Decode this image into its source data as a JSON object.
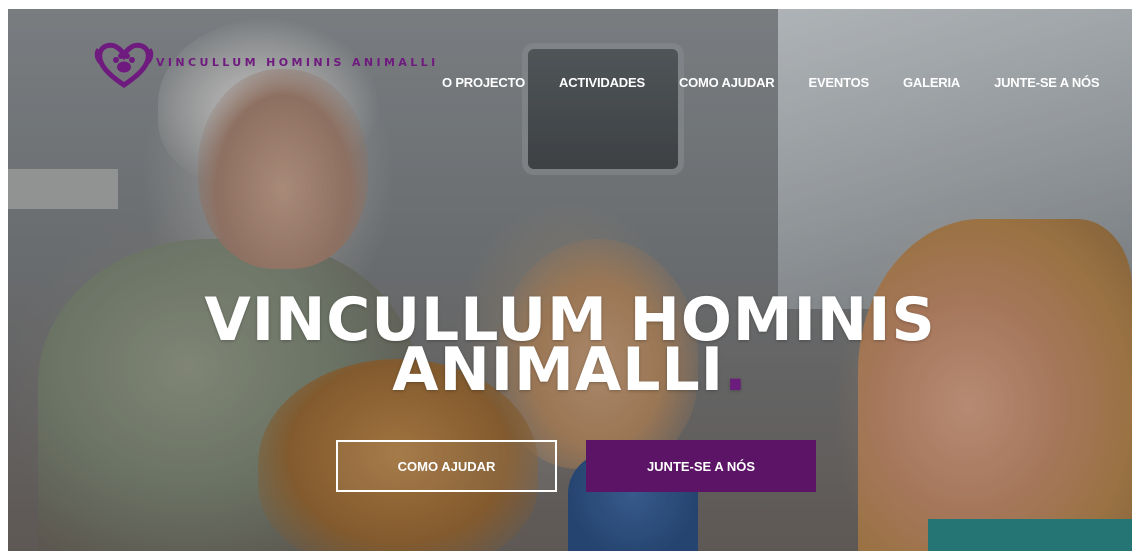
{
  "brand": {
    "name": "VINCULLUM HOMINIS ANIMALLI",
    "logo_icon": "heart-paw-icon",
    "color": "#6e1a7e"
  },
  "nav": {
    "items": [
      {
        "label": "O PROJECTO"
      },
      {
        "label": "ACTIVIDADES"
      },
      {
        "label": "COMO AJUDAR"
      },
      {
        "label": "EVENTOS"
      },
      {
        "label": "GALERIA"
      },
      {
        "label": "JUNTE-SE A NÓS"
      }
    ]
  },
  "hero": {
    "title_line1": "VINCULLUM HOMINIS",
    "title_line2": "ANIMALLI",
    "title_accent": ".",
    "accent_color": "#6b1c7c"
  },
  "buttons": {
    "primary_outline": "COMO AJUDAR",
    "primary_solid": "JUNTE-SE A NÓS",
    "solid_color": "#5b1466"
  }
}
